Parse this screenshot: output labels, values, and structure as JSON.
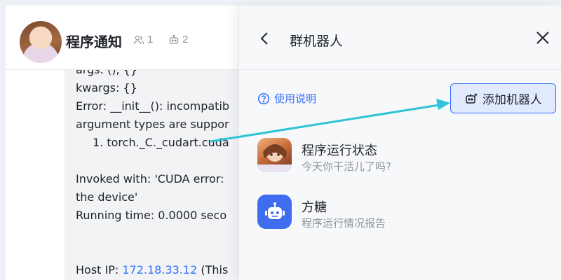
{
  "chat": {
    "group_name": "程序通知",
    "member_count": "1",
    "bot_count": "2",
    "lines": [
      "kwargs: {}",
      "Error: __init__(): incompatib",
      "argument types are suppor",
      "1. torch._C._cudart.cuda",
      "Invoked with: 'CUDA error:",
      "the device'",
      "Running time: 0.0000 seco",
      "Host IP:",
      "172.18.33.12",
      "(This"
    ]
  },
  "panel": {
    "title": "群机器人",
    "help_label": "使用说明",
    "add_button_label": "添加机器人",
    "bots": [
      {
        "name": "程序运行状态",
        "desc": "今天你干活儿了吗?"
      },
      {
        "name": "方糖",
        "desc": "程序运行情况报告"
      }
    ]
  },
  "colors": {
    "accent": "#3370ff",
    "arrow": "#2ec4d6",
    "bot_blue": "#3f6df0"
  }
}
